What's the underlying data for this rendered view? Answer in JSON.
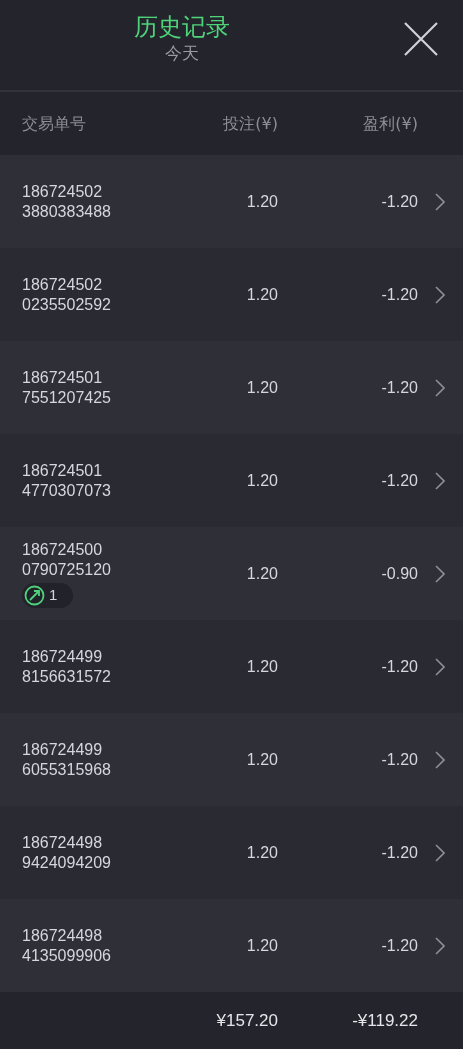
{
  "header": {
    "title": "历史记录",
    "subtitle": "今天"
  },
  "columns": [
    "交易单号",
    "投注(¥)",
    "盈利(¥)"
  ],
  "rows": [
    {
      "id_line_1": "186724502",
      "id_line_2": "3880383488",
      "stake": "1.20",
      "profit": "-1.20"
    },
    {
      "id_line_1": "186724502",
      "id_line_2": "0235502592",
      "stake": "1.20",
      "profit": "-1.20"
    },
    {
      "id_line_1": "186724501",
      "id_line_2": "7551207425",
      "stake": "1.20",
      "profit": "-1.20"
    },
    {
      "id_line_1": "186724501",
      "id_line_2": "4770307073",
      "stake": "1.20",
      "profit": "-1.20"
    },
    {
      "id_line_1": "186724500",
      "id_line_2": "0790725120",
      "stake": "1.20",
      "profit": "-0.90",
      "badge": "1"
    },
    {
      "id_line_1": "186724499",
      "id_line_2": "8156631572",
      "stake": "1.20",
      "profit": "-1.20"
    },
    {
      "id_line_1": "186724499",
      "id_line_2": "6055315968",
      "stake": "1.20",
      "profit": "-1.20"
    },
    {
      "id_line_1": "186724498",
      "id_line_2": "9424094209",
      "stake": "1.20",
      "profit": "-1.20"
    },
    {
      "id_line_1": "186724498",
      "id_line_2": "4135099906",
      "stake": "1.20",
      "profit": "-1.20"
    }
  ],
  "totals": {
    "stake": "¥157.20",
    "profit": "-¥119.22"
  }
}
